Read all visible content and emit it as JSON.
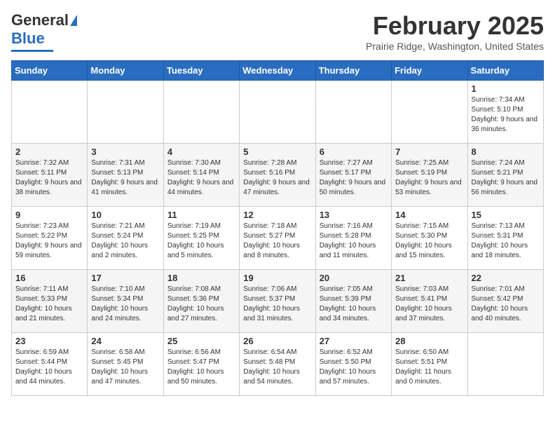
{
  "header": {
    "logo_general": "General",
    "logo_blue": "Blue",
    "month_title": "February 2025",
    "location": "Prairie Ridge, Washington, United States"
  },
  "calendar": {
    "days_of_week": [
      "Sunday",
      "Monday",
      "Tuesday",
      "Wednesday",
      "Thursday",
      "Friday",
      "Saturday"
    ],
    "weeks": [
      [
        {
          "day": "",
          "info": ""
        },
        {
          "day": "",
          "info": ""
        },
        {
          "day": "",
          "info": ""
        },
        {
          "day": "",
          "info": ""
        },
        {
          "day": "",
          "info": ""
        },
        {
          "day": "",
          "info": ""
        },
        {
          "day": "1",
          "info": "Sunrise: 7:34 AM\nSunset: 5:10 PM\nDaylight: 9 hours and 36 minutes."
        }
      ],
      [
        {
          "day": "2",
          "info": "Sunrise: 7:32 AM\nSunset: 5:11 PM\nDaylight: 9 hours and 38 minutes."
        },
        {
          "day": "3",
          "info": "Sunrise: 7:31 AM\nSunset: 5:13 PM\nDaylight: 9 hours and 41 minutes."
        },
        {
          "day": "4",
          "info": "Sunrise: 7:30 AM\nSunset: 5:14 PM\nDaylight: 9 hours and 44 minutes."
        },
        {
          "day": "5",
          "info": "Sunrise: 7:28 AM\nSunset: 5:16 PM\nDaylight: 9 hours and 47 minutes."
        },
        {
          "day": "6",
          "info": "Sunrise: 7:27 AM\nSunset: 5:17 PM\nDaylight: 9 hours and 50 minutes."
        },
        {
          "day": "7",
          "info": "Sunrise: 7:25 AM\nSunset: 5:19 PM\nDaylight: 9 hours and 53 minutes."
        },
        {
          "day": "8",
          "info": "Sunrise: 7:24 AM\nSunset: 5:21 PM\nDaylight: 9 hours and 56 minutes."
        }
      ],
      [
        {
          "day": "9",
          "info": "Sunrise: 7:23 AM\nSunset: 5:22 PM\nDaylight: 9 hours and 59 minutes."
        },
        {
          "day": "10",
          "info": "Sunrise: 7:21 AM\nSunset: 5:24 PM\nDaylight: 10 hours and 2 minutes."
        },
        {
          "day": "11",
          "info": "Sunrise: 7:19 AM\nSunset: 5:25 PM\nDaylight: 10 hours and 5 minutes."
        },
        {
          "day": "12",
          "info": "Sunrise: 7:18 AM\nSunset: 5:27 PM\nDaylight: 10 hours and 8 minutes."
        },
        {
          "day": "13",
          "info": "Sunrise: 7:16 AM\nSunset: 5:28 PM\nDaylight: 10 hours and 11 minutes."
        },
        {
          "day": "14",
          "info": "Sunrise: 7:15 AM\nSunset: 5:30 PM\nDaylight: 10 hours and 15 minutes."
        },
        {
          "day": "15",
          "info": "Sunrise: 7:13 AM\nSunset: 5:31 PM\nDaylight: 10 hours and 18 minutes."
        }
      ],
      [
        {
          "day": "16",
          "info": "Sunrise: 7:11 AM\nSunset: 5:33 PM\nDaylight: 10 hours and 21 minutes."
        },
        {
          "day": "17",
          "info": "Sunrise: 7:10 AM\nSunset: 5:34 PM\nDaylight: 10 hours and 24 minutes."
        },
        {
          "day": "18",
          "info": "Sunrise: 7:08 AM\nSunset: 5:36 PM\nDaylight: 10 hours and 27 minutes."
        },
        {
          "day": "19",
          "info": "Sunrise: 7:06 AM\nSunset: 5:37 PM\nDaylight: 10 hours and 31 minutes."
        },
        {
          "day": "20",
          "info": "Sunrise: 7:05 AM\nSunset: 5:39 PM\nDaylight: 10 hours and 34 minutes."
        },
        {
          "day": "21",
          "info": "Sunrise: 7:03 AM\nSunset: 5:41 PM\nDaylight: 10 hours and 37 minutes."
        },
        {
          "day": "22",
          "info": "Sunrise: 7:01 AM\nSunset: 5:42 PM\nDaylight: 10 hours and 40 minutes."
        }
      ],
      [
        {
          "day": "23",
          "info": "Sunrise: 6:59 AM\nSunset: 5:44 PM\nDaylight: 10 hours and 44 minutes."
        },
        {
          "day": "24",
          "info": "Sunrise: 6:58 AM\nSunset: 5:45 PM\nDaylight: 10 hours and 47 minutes."
        },
        {
          "day": "25",
          "info": "Sunrise: 6:56 AM\nSunset: 5:47 PM\nDaylight: 10 hours and 50 minutes."
        },
        {
          "day": "26",
          "info": "Sunrise: 6:54 AM\nSunset: 5:48 PM\nDaylight: 10 hours and 54 minutes."
        },
        {
          "day": "27",
          "info": "Sunrise: 6:52 AM\nSunset: 5:50 PM\nDaylight: 10 hours and 57 minutes."
        },
        {
          "day": "28",
          "info": "Sunrise: 6:50 AM\nSunset: 5:51 PM\nDaylight: 11 hours and 0 minutes."
        },
        {
          "day": "",
          "info": ""
        }
      ]
    ]
  }
}
